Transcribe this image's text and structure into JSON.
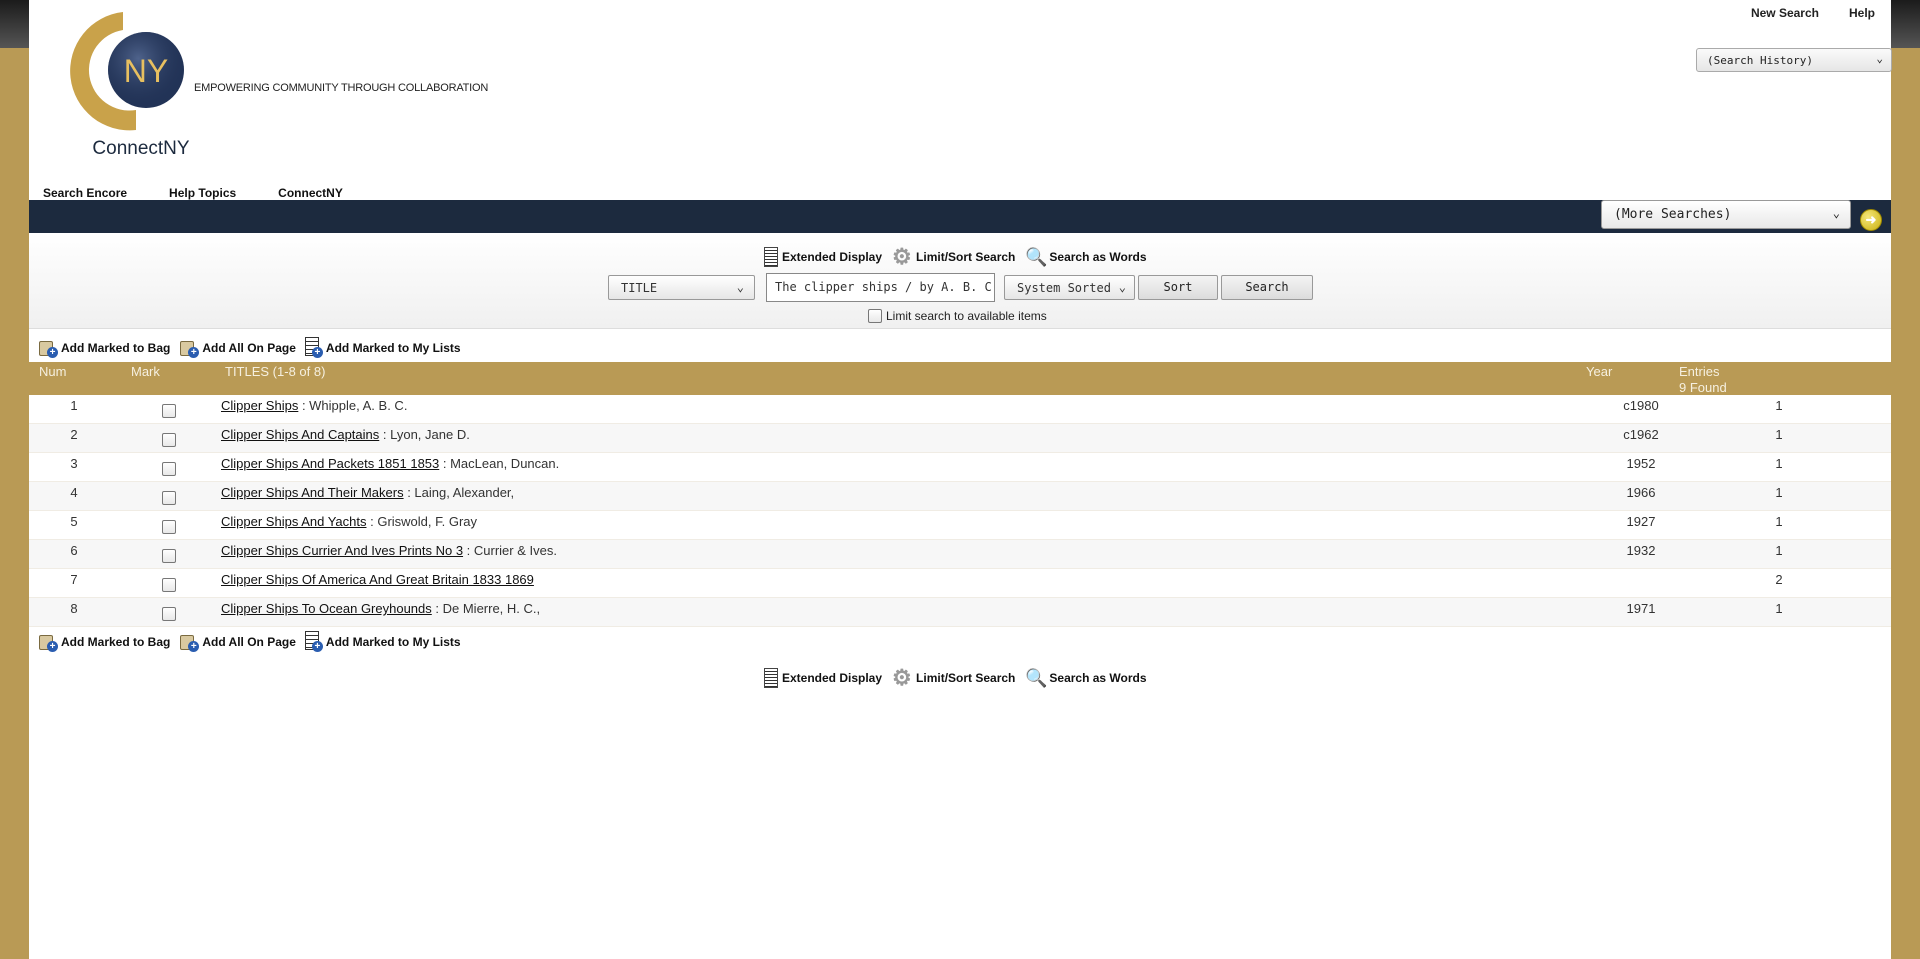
{
  "header": {
    "logo_text": "NY",
    "logo_name": "ConnectNY",
    "tagline": "EMPOWERING COMMUNITY THROUGH COLLABORATION",
    "top_links": [
      "New Search",
      "Help"
    ],
    "search_history": "(Search History)"
  },
  "nav": {
    "links": [
      "Search Encore",
      "Help Topics",
      "ConnectNY"
    ],
    "more_searches": "(More Searches)"
  },
  "search": {
    "tools": {
      "extended_display": "Extended Display",
      "limit_sort": "Limit/Sort Search",
      "search_as_words": "Search as Words"
    },
    "index": "TITLE",
    "query": "The clipper ships / by A. B. C",
    "sort_option": "System Sorted",
    "sort_button": "Sort",
    "search_button": "Search",
    "limit_available": "Limit search to available items"
  },
  "actions": {
    "add_marked_bag": "Add Marked to Bag",
    "add_all_page": "Add All On Page",
    "add_marked_lists": "Add Marked to My Lists"
  },
  "table": {
    "headers": {
      "num": "Num",
      "mark": "Mark",
      "titles": "TITLES (1-8 of 8)",
      "year": "Year",
      "entries": "Entries",
      "found": "9 Found"
    },
    "rows": [
      {
        "num": "1",
        "title": "Clipper Ships",
        "author": " : Whipple, A. B. C.",
        "year": "c1980",
        "entries": "1"
      },
      {
        "num": "2",
        "title": "Clipper Ships And Captains",
        "author": " : Lyon, Jane D.",
        "year": "c1962",
        "entries": "1"
      },
      {
        "num": "3",
        "title": "Clipper Ships And Packets 1851 1853",
        "author": " : MacLean, Duncan.",
        "year": "1952",
        "entries": "1"
      },
      {
        "num": "4",
        "title": "Clipper Ships And Their Makers",
        "author": " : Laing, Alexander,",
        "year": "1966",
        "entries": "1"
      },
      {
        "num": "5",
        "title": "Clipper Ships And Yachts",
        "author": " : Griswold, F. Gray",
        "year": "1927",
        "entries": "1"
      },
      {
        "num": "6",
        "title": "Clipper Ships Currier And Ives Prints No 3",
        "author": " : Currier & Ives.",
        "year": "1932",
        "entries": "1"
      },
      {
        "num": "7",
        "title": "Clipper Ships Of America And Great Britain 1833 1869",
        "author": "",
        "year": "",
        "entries": "2"
      },
      {
        "num": "8",
        "title": "Clipper Ships To Ocean Greyhounds",
        "author": " : De Mierre, H. C.,",
        "year": "1971",
        "entries": "1"
      }
    ]
  },
  "colors": {
    "gold": "#b99a55",
    "navy": "#1c2a3e"
  }
}
